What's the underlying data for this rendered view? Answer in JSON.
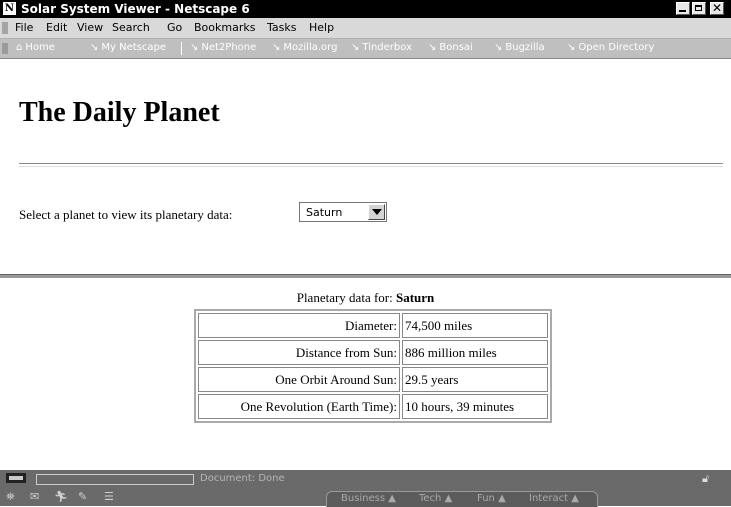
{
  "window": {
    "title": "Solar System Viewer - Netscape 6",
    "app_icon": "netscape-icon",
    "controls": [
      "minimize-icon",
      "maximize-icon",
      "close-icon"
    ]
  },
  "menubar": {
    "items": [
      "File",
      "Edit",
      "View",
      "Search",
      "Go",
      "Bookmarks",
      "Tasks",
      "Help"
    ]
  },
  "personal_toolbar": {
    "home": "Home",
    "my_netscape": "My Netscape",
    "bookmarks": [
      "Net2Phone",
      "Mozilla.org",
      "Tinderbox",
      "Bonsai",
      "Bugzilla",
      "Open Directory"
    ]
  },
  "page": {
    "heading": "The Daily Planet",
    "select_label": "Select a planet to view its planetary data:",
    "select_value": "Saturn"
  },
  "planet_data": {
    "caption_prefix": "Planetary data for:",
    "planet": "Saturn",
    "rows": [
      {
        "label": "Diameter:",
        "value": "74,500 miles"
      },
      {
        "label": "Distance from Sun:",
        "value": "886 million miles"
      },
      {
        "label": "One Orbit Around Sun:",
        "value": "29.5 years"
      },
      {
        "label": "One Revolution (Earth Time):",
        "value": "10 hours, 39 minutes"
      }
    ]
  },
  "status": {
    "text": "Document: Done"
  },
  "taskbar": {
    "tabs": [
      "Business",
      "Tech",
      "Fun",
      "Interact"
    ]
  },
  "colors": {
    "titlebar": "#000000",
    "chrome": "#d9d9d9",
    "status_bg": "#6a6a6a"
  }
}
